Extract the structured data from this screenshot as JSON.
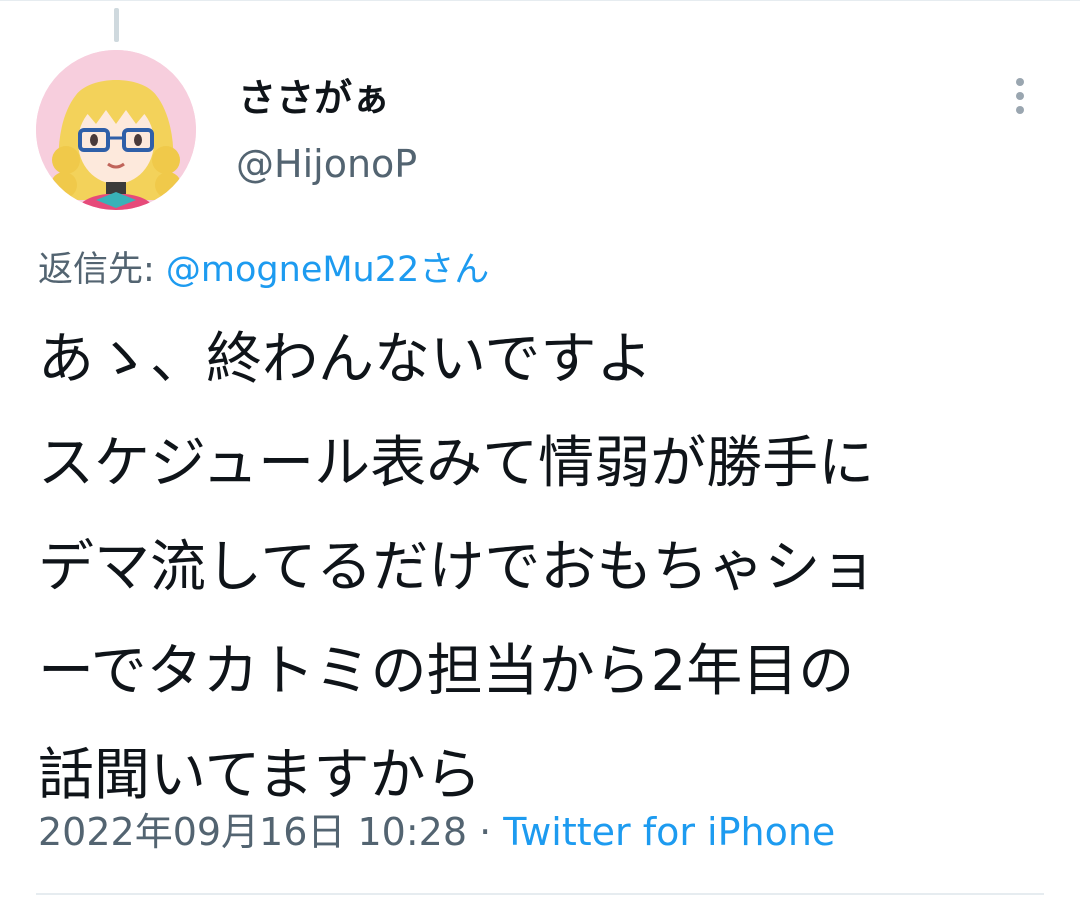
{
  "tweet": {
    "author": {
      "display_name": "ささがぁ",
      "handle": "@HijonoP",
      "avatar_icon": "anime-girl-avatar-icon"
    },
    "more_icon": "more-vertical-icon",
    "reply_prefix": "返信先: ",
    "reply_to": "@mogneMu22さん",
    "text_lines": [
      "あゝ、終わんないですよ",
      "スケジュール表みて情弱が勝手に",
      "デマ流してるだけでおもちゃショ",
      "ーでタカトミの担当から2年目の",
      "話聞いてますから"
    ],
    "timestamp": "2022年09月16日 10:28",
    "separator": " · ",
    "source": "Twitter for iPhone"
  },
  "colors": {
    "text_primary": "#0f1419",
    "text_secondary": "#536471",
    "link": "#1d9bf0",
    "divider": "#e6ecf0",
    "avatar_bg": "#f7cedd"
  }
}
